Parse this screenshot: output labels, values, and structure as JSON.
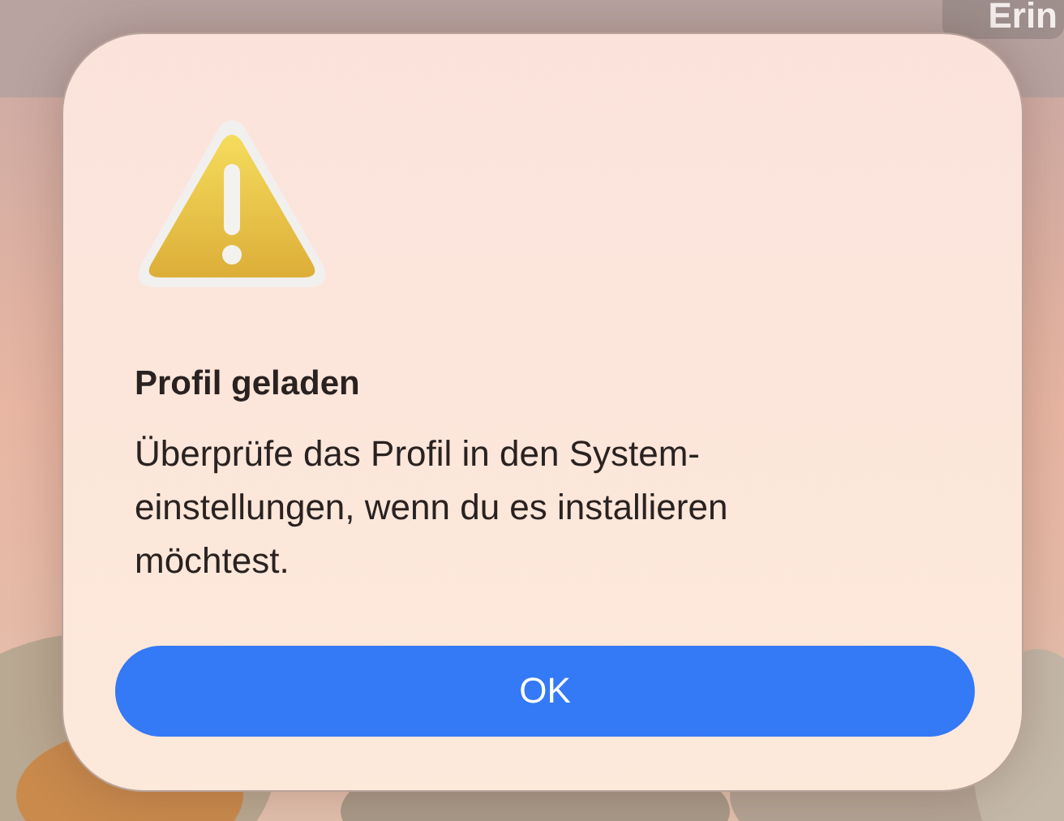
{
  "background_button": {
    "label": "Erin"
  },
  "alert": {
    "title": "Profil geladen",
    "message": "Überprüfe das Profil in den System-einstellungen, wenn du es installieren möchtest.",
    "buttons": [
      {
        "label": "OK",
        "kind": "primary"
      }
    ]
  }
}
